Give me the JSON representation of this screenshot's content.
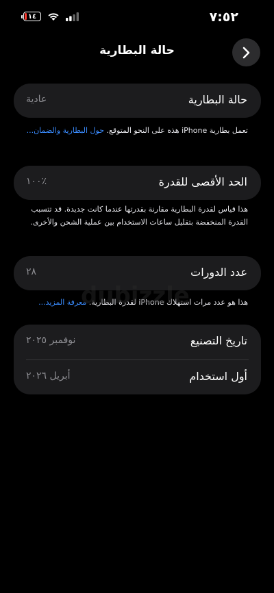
{
  "status_bar": {
    "time": "٧:٥٢",
    "battery_level": "١٤",
    "battery_color": "#ff3b30",
    "battery_fraction": 0.14,
    "signal_icon": "cellular-signal-icon",
    "wifi_icon": "wifi-icon"
  },
  "nav": {
    "title": "حالة البطارية",
    "back_icon": "chevron-right-icon"
  },
  "battery_condition": {
    "label": "حالة البطارية",
    "value": "عادية",
    "note": "تعمل بطارية iPhone هذه على النحو المتوقع.",
    "link": "حول البطارية والضمان..."
  },
  "maximum_capacity": {
    "label": "الحد الأقصى للقدرة",
    "value": "٪١٠٠",
    "note": "هذا قياس لقدرة البطارية مقارنة بقدرتها عندما كانت جديدة. قد تتسبب القدرة المنخفضة بتقليل ساعات الاستخدام بين عملية الشحن والأخرى."
  },
  "cycle_count": {
    "label": "عدد الدورات",
    "value": "٢٨",
    "note": "هذا هو عدد مرات استهلاك iPhone لقدرة البطارية.",
    "link": "معرفة المزيد..."
  },
  "dates": {
    "manufacture_label": "تاريخ التصنيع",
    "manufacture_value": "نوفمبر ٢٠٢٥",
    "first_use_label": "أول استخدام",
    "first_use_value": "أبريل ٢٠٢٦"
  },
  "watermark": "dubizzle",
  "accent_color": "#3a8cff"
}
